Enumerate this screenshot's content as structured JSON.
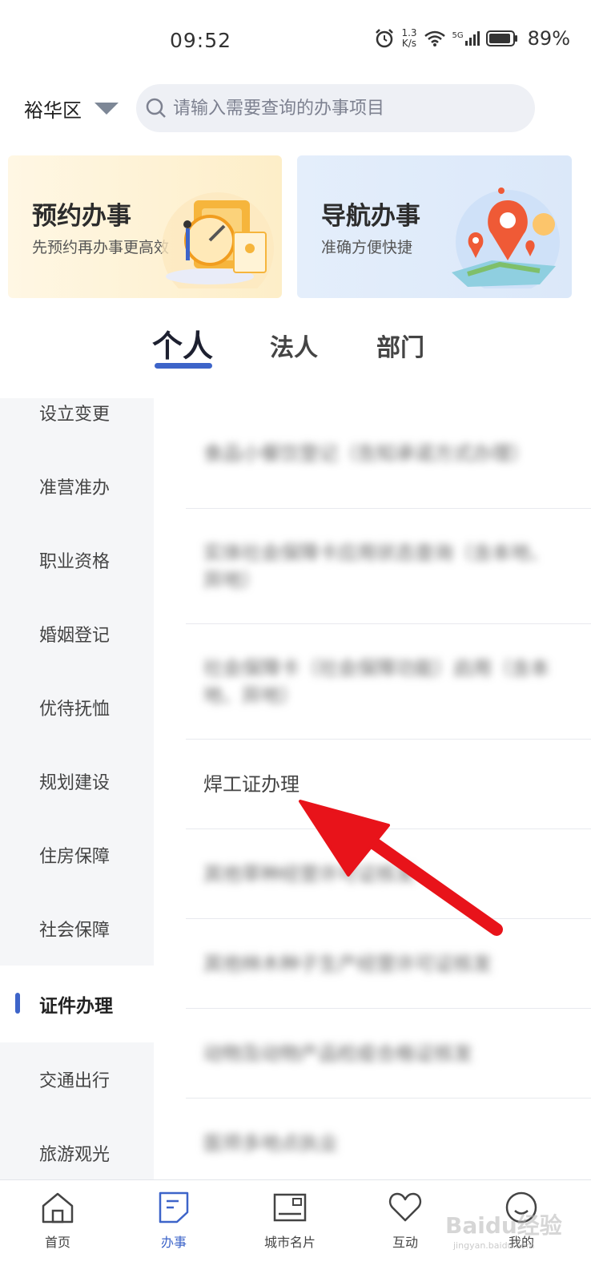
{
  "status": {
    "time": "09:52",
    "speed_value": "1.3",
    "speed_unit": "K/s",
    "network": "5G",
    "battery": "89%"
  },
  "header": {
    "region": "裕华区",
    "search_placeholder": "请输入需要查询的办事项目"
  },
  "banners": [
    {
      "title": "预约办事",
      "subtitle": "先预约再办事更高效"
    },
    {
      "title": "导航办事",
      "subtitle": "准确方便快捷"
    }
  ],
  "tabs": [
    {
      "label": "个人",
      "active": true
    },
    {
      "label": "法人",
      "active": false
    },
    {
      "label": "部门",
      "active": false
    }
  ],
  "sidebar": {
    "items": [
      {
        "label": "设立变更"
      },
      {
        "label": "准营准办"
      },
      {
        "label": "职业资格"
      },
      {
        "label": "婚姻登记"
      },
      {
        "label": "优待抚恤"
      },
      {
        "label": "规划建设"
      },
      {
        "label": "住房保障"
      },
      {
        "label": "社会保障"
      },
      {
        "label": "证件办理",
        "active": true
      },
      {
        "label": "交通出行"
      },
      {
        "label": "旅游观光"
      }
    ]
  },
  "services": {
    "items": [
      {
        "label": "食品小餐饮登记（告知承诺方式办理）",
        "blurred": true
      },
      {
        "label": "实体社会保障卡应用状态查询（含本地、异地）",
        "blurred": true
      },
      {
        "label": "社会保障卡（社会保障功能）启用（含本地、异地）",
        "blurred": true
      },
      {
        "label": "焊工证办理",
        "blurred": false
      },
      {
        "label": "其他草种经营许可证核发",
        "blurred": true
      },
      {
        "label": "其他林木种子生产经营许可证核发",
        "blurred": true
      },
      {
        "label": "动物及动物产品检疫合格证核发",
        "blurred": true
      },
      {
        "label": "医师多地点执业",
        "blurred": true
      }
    ]
  },
  "bottom_nav": {
    "items": [
      {
        "label": "首页",
        "icon": "home-icon"
      },
      {
        "label": "办事",
        "icon": "document-icon",
        "active": true
      },
      {
        "label": "城市名片",
        "icon": "postcard-icon"
      },
      {
        "label": "互动",
        "icon": "heart-icon"
      },
      {
        "label": "我的",
        "icon": "profile-icon"
      }
    ]
  },
  "watermark": {
    "text": "Baidu经验",
    "sub": "jingyan.baidu.com"
  },
  "colors": {
    "accent": "#3d64c9",
    "arrow": "#e8131a",
    "sidebar_bg": "#f5f6f8"
  }
}
